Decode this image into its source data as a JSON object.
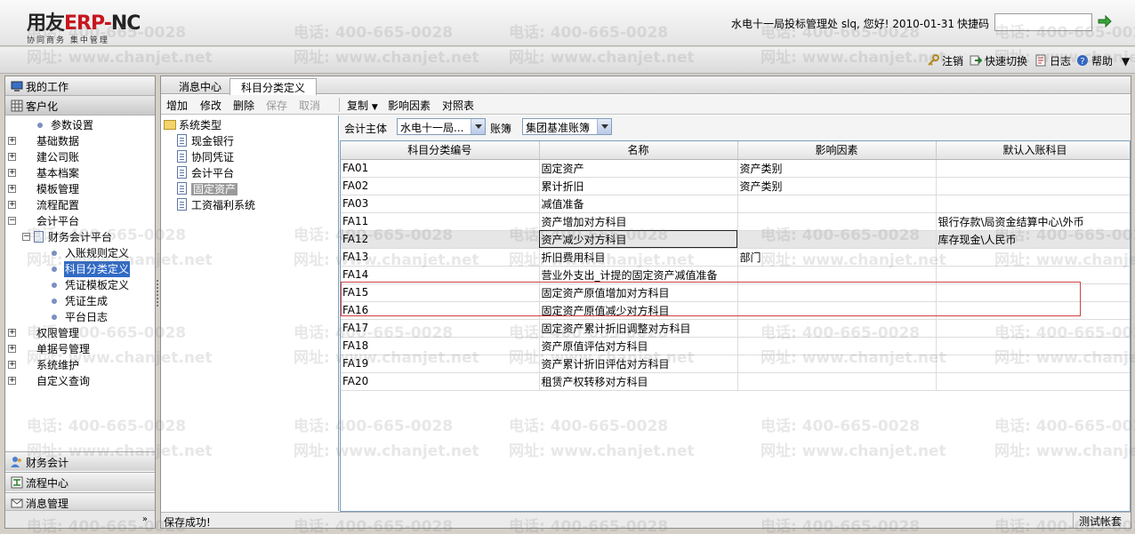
{
  "header": {
    "logo_brand": "用友",
    "logo_erp": "ERP-",
    "logo_suffix": "NC",
    "logo_tagline": "协同商务   集中管理",
    "welcome": "水电十一局投标管理处 slq, 您好! 2010-01-31",
    "quickcode_label": "快捷码",
    "quickcode_value": ""
  },
  "topbar": {
    "logout": "注销",
    "quick_switch": "快速切换",
    "log": "日志",
    "help": "帮助"
  },
  "left_nav": {
    "my_work": "我的工作",
    "client": "客户化",
    "tree": [
      {
        "label": "参数设置",
        "level": 1,
        "kind": "leaf"
      },
      {
        "label": "基础数据",
        "level": 0,
        "kind": "plus"
      },
      {
        "label": "建公司账",
        "level": 0,
        "kind": "plus"
      },
      {
        "label": "基本档案",
        "level": 0,
        "kind": "plus"
      },
      {
        "label": "模板管理",
        "level": 0,
        "kind": "plus"
      },
      {
        "label": "流程配置",
        "level": 0,
        "kind": "plus"
      },
      {
        "label": "会计平台",
        "level": 0,
        "kind": "minus"
      },
      {
        "label": "财务会计平台",
        "level": 1,
        "kind": "minus-doc"
      },
      {
        "label": "入账规则定义",
        "level": 2,
        "kind": "leaf"
      },
      {
        "label": "科目分类定义",
        "level": 2,
        "kind": "leaf",
        "selected": true
      },
      {
        "label": "凭证模板定义",
        "level": 2,
        "kind": "leaf"
      },
      {
        "label": "凭证生成",
        "level": 2,
        "kind": "leaf"
      },
      {
        "label": "平台日志",
        "level": 2,
        "kind": "leaf"
      },
      {
        "label": "权限管理",
        "level": 0,
        "kind": "plus"
      },
      {
        "label": "单据号管理",
        "level": 0,
        "kind": "plus"
      },
      {
        "label": "系统维护",
        "level": 0,
        "kind": "plus"
      },
      {
        "label": "自定义查询",
        "level": 0,
        "kind": "plus"
      }
    ],
    "bottom": {
      "finance": "财务会计",
      "flow": "流程中心",
      "message": "消息管理"
    },
    "collapse_glyph": "»"
  },
  "tabs": {
    "message_center": "消息中心",
    "subject_classification": "科目分类定义"
  },
  "actions": {
    "add": "增加",
    "edit": "修改",
    "delete": "删除",
    "save": "保存",
    "cancel": "取消",
    "copy": "复制",
    "factors": "影响因素",
    "mapping": "对照表"
  },
  "systree": {
    "root": "系统类型",
    "items": [
      "现金银行",
      "协同凭证",
      "会计平台",
      "固定资产",
      "工资福利系统"
    ],
    "selected_index": 3
  },
  "filter": {
    "entity_label": "会计主体",
    "entity_value": "水电十一局...",
    "book_label": "账簿",
    "book_value": "集团基准账簿"
  },
  "grid": {
    "headers": [
      "科目分类编号",
      "名称",
      "影响因素",
      "默认入账科目"
    ],
    "rows": [
      [
        "FA01",
        "固定资产",
        "资产类别",
        ""
      ],
      [
        "FA02",
        "累计折旧",
        "资产类别",
        ""
      ],
      [
        "FA03",
        "减值准备",
        "",
        ""
      ],
      [
        "FA11",
        "资产增加对方科目",
        "",
        "银行存款\\局资金结算中心\\外币"
      ],
      [
        "FA12",
        "资产减少对方科目",
        "",
        "库存现金\\人民币"
      ],
      [
        "FA13",
        "折旧费用科目",
        "部门",
        ""
      ],
      [
        "FA14",
        "营业外支出_计提的固定资产减值准备",
        "",
        ""
      ],
      [
        "FA15",
        "固定资产原值增加对方科目",
        "",
        ""
      ],
      [
        "FA16",
        "固定资产原值减少对方科目",
        "",
        ""
      ],
      [
        "FA17",
        "固定资产累计折旧调整对方科目",
        "",
        ""
      ],
      [
        "FA18",
        "资产原值评估对方科目",
        "",
        ""
      ],
      [
        "FA19",
        "资产累计折旧评估对方科目",
        "",
        ""
      ],
      [
        "FA20",
        "租赁产权转移对方科目",
        "",
        ""
      ]
    ],
    "selected_row": 4
  },
  "status": {
    "message": "保存成功!",
    "account": "测试帐套"
  },
  "watermark": {
    "phone": "电话: 400-665-0028",
    "site": "网址: www.chanjet.net"
  },
  "colors": {
    "selection": "#316ac5",
    "highlight_box": "#d04040",
    "grid_border": "#7f9db9",
    "logo_red": "#c8161d"
  }
}
